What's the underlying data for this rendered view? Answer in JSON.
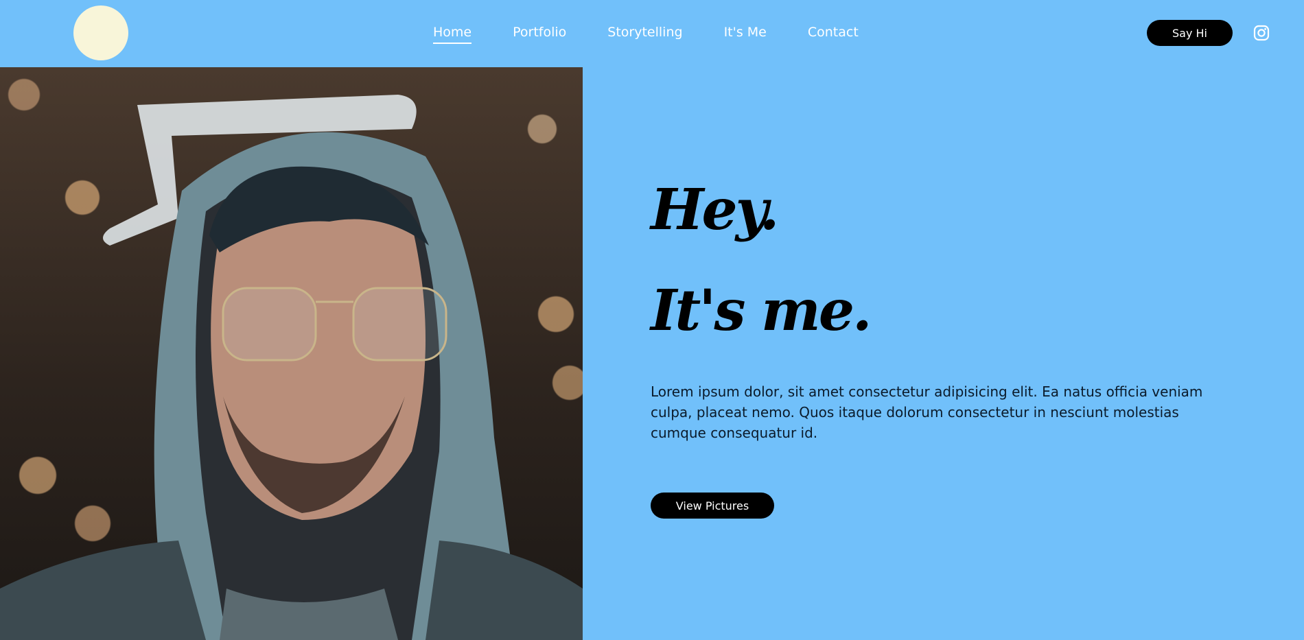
{
  "header": {
    "nav": [
      {
        "label": "Home",
        "active": true
      },
      {
        "label": "Portfolio"
      },
      {
        "label": "Storytelling"
      },
      {
        "label": "It's Me"
      },
      {
        "label": "Contact"
      }
    ],
    "cta_label": "Say Hi",
    "social_icon": "instagram-icon"
  },
  "hero": {
    "headline_1": "Hey.",
    "headline_2": "It's me.",
    "description": "Lorem ipsum dolor, sit amet consectetur adipisicing elit. Ea natus officia veniam culpa, placeat nemo. Quos itaque dolorum consectetur in nesciunt molestias cumque consequatur id.",
    "button_label": "View Pictures"
  },
  "colors": {
    "background": "#71c0fa",
    "logo": "#f8f5d9",
    "button": "#000000",
    "text_light": "#ffffff"
  }
}
